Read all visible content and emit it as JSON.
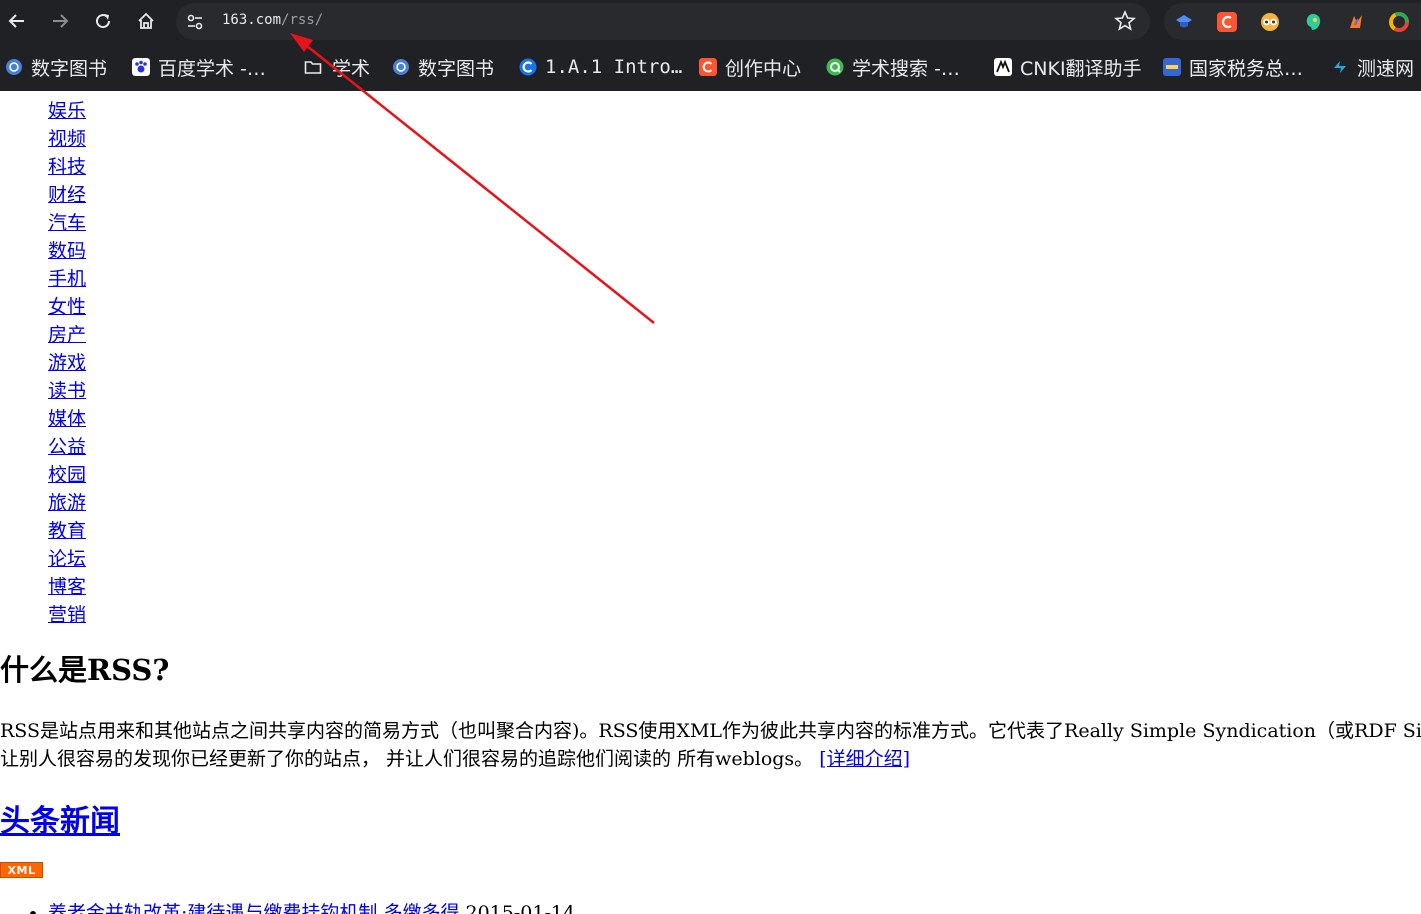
{
  "browser": {
    "url_host": "163.com",
    "url_path": "/rss/",
    "bookmarks": [
      {
        "label": "数字图书",
        "icon": "globe-blue-icon",
        "color": "#4a7fd6"
      },
      {
        "label": "百度学术 -…",
        "icon": "baidu-paw-icon",
        "color": "#2932e1"
      },
      {
        "label": "学术",
        "icon": "folder-icon",
        "color": "#e8eaed"
      },
      {
        "label": "数字图书",
        "icon": "globe-blue-icon",
        "color": "#4a7fd6"
      },
      {
        "label": "1.A.1 Intro…",
        "icon": "c-logo-blue-icon",
        "color": "#1a73e8"
      },
      {
        "label": "创作中心",
        "icon": "csdn-c-icon",
        "color": "#fc5531"
      },
      {
        "label": "学术搜索 -…",
        "icon": "green-q-icon",
        "color": "#3fb950"
      },
      {
        "label": "CNKI翻译助手",
        "icon": "cnki-icon",
        "color": "#ffffff"
      },
      {
        "label": "国家税务总…",
        "icon": "tax-icon",
        "color": "#3367d6"
      },
      {
        "label": "测速网",
        "icon": "speedtest-icon",
        "color": "#29a8e0"
      }
    ],
    "extensions": [
      "graduation-cap-icon",
      "csdn-c-icon",
      "owl-icon",
      "green-head-icon",
      "fox-icon",
      "chrome-ring-icon"
    ]
  },
  "nav": [
    "娱乐",
    "视频",
    "科技",
    "财经",
    "汽车",
    "数码",
    "手机",
    "女性",
    "房产",
    "游戏",
    "读书",
    "媒体",
    "公益",
    "校园",
    "旅游",
    "教育",
    "论坛",
    "博客",
    "营销"
  ],
  "rss": {
    "title": "什么是RSS?",
    "line1": "RSS是站点用来和其他站点之间共享内容的简易方式（也叫聚合内容)。RSS使用XML作为彼此共享内容的标准方式。它代表了Really Simple Syndication（或RDF Site Summary",
    "line2": "让别人很容易的发现你已经更新了你的站点， 并让人们很容易的追踪他们阅读的 所有weblogs。",
    "more_link": "[详细介绍]"
  },
  "headline": {
    "title": "头条新闻",
    "xml_badge": "XML",
    "items": [
      {
        "title": "养老金并轨改革:建待遇与缴费挂钩机制 多缴多得",
        "date": "2015-01-14"
      }
    ]
  },
  "colors": {
    "link": "#0000ee",
    "arrow": "#e8131a",
    "xml_badge": "#ff6600",
    "chrome_bg": "#202124"
  }
}
